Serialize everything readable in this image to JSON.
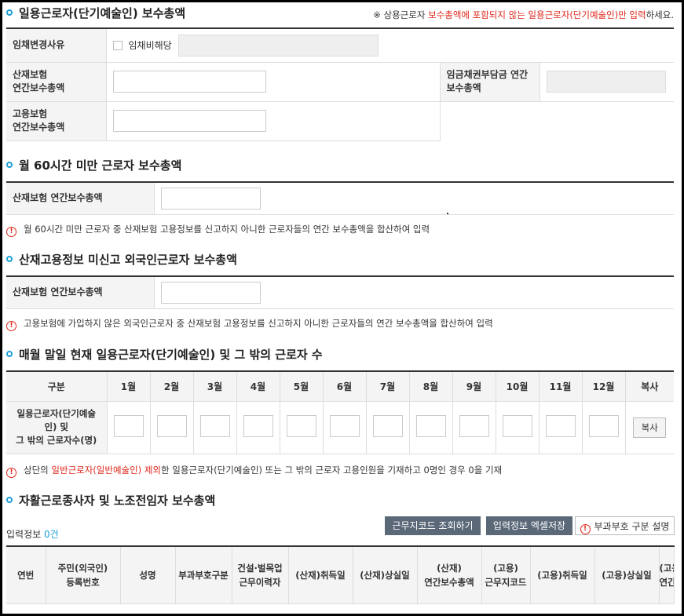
{
  "sections": {
    "daily": {
      "title": "일용근로자(단기예술인) 보수총액",
      "notice_prefix": "※ 상용근로자 ",
      "notice_red": "보수총액에 포함되지 않는 일용근로자(단기예술인)만 입력",
      "notice_suffix": "하세요.",
      "row_reason_label": "임채변경사유",
      "reason_checkbox_label": "임채비해당",
      "row_sanjae_label_1": "산재보험",
      "row_sanjae_label_2": "연간보수총액",
      "row_wage_label_1": "임금채권부담금 연간",
      "row_wage_label_2": "보수총액",
      "row_goyong_label_1": "고용보험",
      "row_goyong_label_2": "연간보수총액"
    },
    "under60": {
      "title": "월 60시간 미만 근로자 보수총액",
      "row_label": "산재보험 연간보수총액",
      "note": "월 60시간 미만 근로자 중 산재보험 고용정보를 신고하지 아니한 근로자들의 연간 보수총액을 합산하여 입력"
    },
    "foreign": {
      "title": "산재고용정보 미신고 외국인근로자 보수총액",
      "row_label": "산재보험 연간보수총액",
      "note": "고용보험에 가입하지 않은 외국인근로자 중 산재보험 고용정보를 신고하지 아니한 근로자들의 연간 보수총액을 합산하여 입력"
    },
    "monthly": {
      "title": "매월 말일 현재 일용근로자(단기예술인) 및 그 밖의 근로자 수",
      "col_category": "구분",
      "months": [
        "1월",
        "2월",
        "3월",
        "4월",
        "5월",
        "6월",
        "7월",
        "8월",
        "9월",
        "10월",
        "11월",
        "12월"
      ],
      "col_copy": "복사",
      "row_label_1": "일용근로자(단기예술",
      "row_label_2": "인) 및",
      "row_label_3": "그 밖의  근로자수(명)",
      "copy_button": "복사",
      "note_prefix": "상단의 ",
      "note_red": "일반근로자(일반예술인) 제외",
      "note_suffix": "한 일용근로자(단기예술인) 또는 그 밖의 근로자 고용인원을 기재하고 0명인 경우 0을 기재"
    },
    "selfemp": {
      "title": "자활근로종사자 및 노조전임자 보수총액",
      "info_label": "입력정보 ",
      "info_count": "0건",
      "btn_lookup": "근무지코드 조회하기",
      "btn_excel": "입력정보 엑셀저장",
      "btn_explain": "부과부호 구분 설명",
      "columns": [
        [
          "연번"
        ],
        [
          "주민(외국인)",
          "등록번호"
        ],
        [
          "성명"
        ],
        [
          "부과부호구분"
        ],
        [
          "건설·벌목업",
          "근무이력자"
        ],
        [
          "(산재)취득일"
        ],
        [
          "(산재)상실일"
        ],
        [
          "(산재)",
          "연간보수총액"
        ],
        [
          "(고용)",
          "근무지코드"
        ],
        [
          "(고용)취득일"
        ],
        [
          "(고용)상실일"
        ],
        [
          "(고용)",
          "연간보"
        ]
      ]
    }
  },
  "colors": {
    "accent": "#1a9ed8",
    "warning": "#e0261b",
    "button": "#5a6878"
  }
}
